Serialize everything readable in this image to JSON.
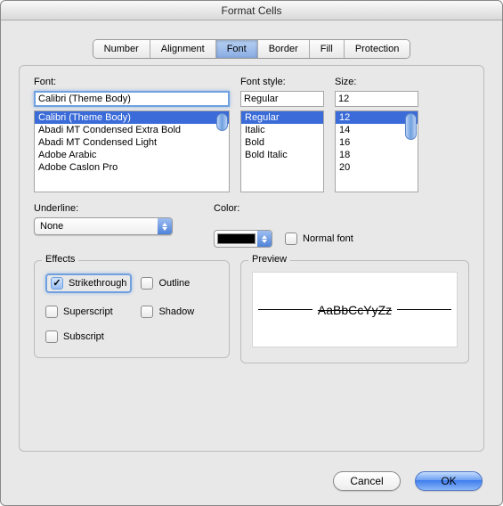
{
  "title": "Format Cells",
  "tabs": [
    "Number",
    "Alignment",
    "Font",
    "Border",
    "Fill",
    "Protection"
  ],
  "active_tab": "Font",
  "font": {
    "label": "Font:",
    "value": "Calibri (Theme Body)",
    "list": [
      "Calibri (Theme Body)",
      "Abadi MT Condensed Extra Bold",
      "Abadi MT Condensed Light",
      "Adobe Arabic",
      "Adobe Caslon Pro"
    ],
    "selected": "Calibri (Theme Body)"
  },
  "style": {
    "label": "Font style:",
    "value": "Regular",
    "list": [
      "Regular",
      "Italic",
      "Bold",
      "Bold Italic"
    ],
    "selected": "Regular"
  },
  "size": {
    "label": "Size:",
    "value": "12",
    "list": [
      "12",
      "14",
      "16",
      "18",
      "20"
    ],
    "selected": "12"
  },
  "underline": {
    "label": "Underline:",
    "value": "None"
  },
  "color": {
    "label": "Color:",
    "swatch": "#000000"
  },
  "normal_font": {
    "label": "Normal font",
    "checked": false
  },
  "effects": {
    "legend": "Effects",
    "strikethrough": {
      "label": "Strikethrough",
      "checked": true
    },
    "outline": {
      "label": "Outline",
      "checked": false
    },
    "superscript": {
      "label": "Superscript",
      "checked": false
    },
    "shadow": {
      "label": "Shadow",
      "checked": false
    },
    "subscript": {
      "label": "Subscript",
      "checked": false
    }
  },
  "preview": {
    "legend": "Preview",
    "text": "AaBbCcYyZz"
  },
  "buttons": {
    "cancel": "Cancel",
    "ok": "OK"
  }
}
